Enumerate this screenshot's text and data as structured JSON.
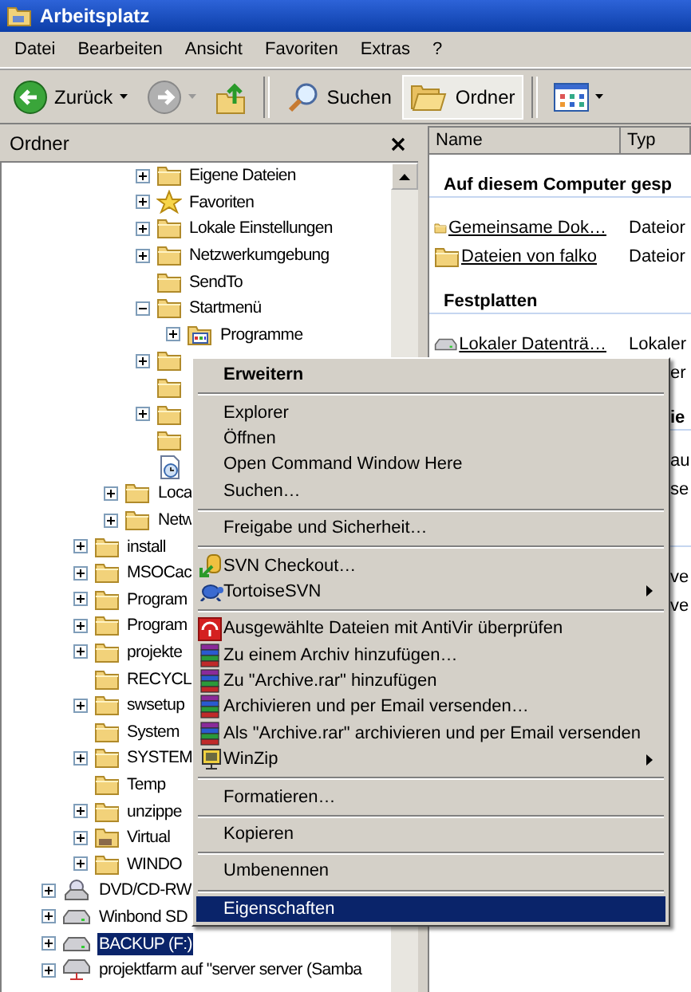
{
  "window": {
    "title": "Arbeitsplatz"
  },
  "menu_bar": [
    "Datei",
    "Bearbeiten",
    "Ansicht",
    "Favoriten",
    "Extras",
    "?"
  ],
  "toolbar": [
    {
      "kind": "back",
      "label": "Zurück",
      "dropdown": true,
      "disabled": false,
      "selected": false
    },
    {
      "kind": "forward",
      "dropdown": true,
      "disabled": true,
      "selected": false
    },
    {
      "kind": "up",
      "selected": false
    },
    {
      "kind": "separator"
    },
    {
      "kind": "search",
      "label": "Suchen",
      "disabled": false,
      "selected": false
    },
    {
      "kind": "folders",
      "label": "Ordner",
      "disabled": false,
      "selected": true
    },
    {
      "kind": "separator"
    },
    {
      "kind": "views",
      "dropdown": true,
      "disabled": false,
      "selected": false
    }
  ],
  "folder_pane": {
    "title": "Ordner",
    "tree": [
      {
        "children": [
          {
            "children": [
              {
                "children": [
                  {
                    "kind": "folder",
                    "label": "Eigene Dateien",
                    "expandable": true,
                    "expanded": false,
                    "selected": false
                  },
                  {
                    "kind": "favorites",
                    "label": "Favoriten",
                    "expandable": true,
                    "expanded": false,
                    "selected": false
                  },
                  {
                    "kind": "folder",
                    "label": "Lokale Einstellungen",
                    "expandable": true,
                    "expanded": false,
                    "selected": false
                  },
                  {
                    "kind": "folder",
                    "label": "Netzwerkumgebung",
                    "expandable": true,
                    "expanded": false,
                    "selected": false
                  },
                  {
                    "kind": "folder",
                    "label": "SendTo",
                    "expandable": false,
                    "selected": false
                  },
                  {
                    "kind": "folder",
                    "label": "Startmenü",
                    "expandable": true,
                    "expanded": true,
                    "selected": false,
                    "children": [
                      {
                        "kind": "programs",
                        "label": "Programme",
                        "expandable": true,
                        "expanded": false,
                        "selected": false
                      }
                    ]
                  },
                  {
                    "kind": "folder",
                    "expandable": true,
                    "expanded": false
                  },
                  {
                    "kind": "folder",
                    "expandable": false
                  },
                  {
                    "kind": "folder",
                    "expandable": true,
                    "expanded": false
                  },
                  {
                    "kind": "folder",
                    "expandable": false
                  },
                  {
                    "kind": "document",
                    "expandable": false
                  }
                ]
              },
              {
                "kind": "folder",
                "label": "Loca",
                "expandable": true,
                "expanded": false,
                "selected": false
              },
              {
                "kind": "folder",
                "label": "Netw",
                "expandable": true,
                "expanded": false,
                "selected": false
              }
            ]
          },
          {
            "kind": "folder",
            "label": "install",
            "expandable": true,
            "expanded": false,
            "selected": false
          },
          {
            "kind": "folder",
            "label": "MSOCac",
            "expandable": true,
            "expanded": false,
            "selected": false
          },
          {
            "kind": "folder",
            "label": "Program",
            "expandable": true,
            "expanded": false,
            "selected": false
          },
          {
            "kind": "folder",
            "label": "Program",
            "expandable": true,
            "expanded": false,
            "selected": false
          },
          {
            "kind": "folder",
            "label": "projekte",
            "expandable": true,
            "expanded": false,
            "selected": false
          },
          {
            "kind": "folder",
            "label": "RECYCL",
            "expandable": false,
            "selected": false
          },
          {
            "kind": "folder",
            "label": "swsetup",
            "expandable": true,
            "expanded": false,
            "selected": false
          },
          {
            "kind": "folder",
            "label": "System",
            "expandable": false,
            "selected": false
          },
          {
            "kind": "folder",
            "label": "SYSTEM",
            "expandable": true,
            "expanded": false,
            "selected": false
          },
          {
            "kind": "folder",
            "label": "Temp",
            "expandable": false,
            "selected": false
          },
          {
            "kind": "folder",
            "label": "unzippe",
            "expandable": true,
            "expanded": false,
            "selected": false
          },
          {
            "kind": "special-folder",
            "label": "Virtual",
            "expandable": true,
            "expanded": false,
            "selected": false
          },
          {
            "kind": "folder",
            "label": "WINDO",
            "expandable": true,
            "expanded": false,
            "selected": false
          }
        ]
      },
      {
        "kind": "cd-drive",
        "label": "DVD/CD-RW",
        "expandable": true,
        "expanded": false,
        "selected": false
      },
      {
        "kind": "drive",
        "label": "Winbond SD",
        "expandable": true,
        "expanded": false,
        "selected": false
      },
      {
        "kind": "drive",
        "label": "BACKUP (F:)",
        "expandable": true,
        "expanded": false,
        "selected": true
      },
      {
        "kind": "network-drive",
        "label": "projektfarm auf \"server server (Samba",
        "expandable": true,
        "expanded": false,
        "selected": false
      }
    ]
  },
  "content_pane": {
    "columns": [
      "Name",
      "Typ"
    ],
    "groups": [
      {
        "title": "Auf diesem Computer gesp",
        "covered": false,
        "items": [
          {
            "kind": "folder",
            "name": "Gemeinsame Dok…",
            "type": "Dateior",
            "covered": false
          },
          {
            "kind": "folder",
            "name": "Dateien von falko",
            "type": "Dateior",
            "covered": false
          }
        ]
      },
      {
        "title": "Festplatten",
        "covered": false,
        "items": [
          {
            "kind": "drive",
            "name": "Lokaler Datenträ…",
            "type": "Lokaler",
            "covered": false
          },
          {
            "text": "er",
            "covered": true
          }
        ]
      },
      {
        "title": "ie",
        "covered": true,
        "items": [
          {
            "text": "au",
            "covered": true
          },
          {
            "text": "se",
            "covered": true
          }
        ]
      },
      {
        "items": [
          {
            "text": "ve",
            "covered": true
          },
          {
            "text": "ve",
            "covered": true
          }
        ]
      }
    ]
  },
  "context_menu": [
    {
      "kind": "item",
      "label": "Erweitern",
      "bold": true,
      "submenu": false,
      "selected": false
    },
    {
      "kind": "separator"
    },
    {
      "kind": "item",
      "label": "Explorer",
      "bold": false,
      "submenu": false,
      "selected": false
    },
    {
      "kind": "item",
      "label": "Öffnen",
      "bold": false,
      "submenu": false,
      "selected": false
    },
    {
      "kind": "item",
      "label": "Open Command Window Here",
      "bold": false,
      "submenu": false,
      "selected": false
    },
    {
      "kind": "item",
      "label": "Suchen…",
      "bold": false,
      "submenu": false,
      "selected": false
    },
    {
      "kind": "separator"
    },
    {
      "kind": "item",
      "label": "Freigabe und Sicherheit…",
      "bold": false,
      "submenu": false,
      "selected": false
    },
    {
      "kind": "separator"
    },
    {
      "kind": "checkout",
      "label": "SVN Checkout…",
      "bold": false,
      "submenu": false,
      "selected": false
    },
    {
      "kind": "tortoise",
      "label": "TortoiseSVN",
      "bold": false,
      "submenu": true,
      "selected": false
    },
    {
      "kind": "separator"
    },
    {
      "kind": "antivir",
      "label": "Ausgewählte Dateien mit AntiVir überprüfen",
      "bold": false,
      "submenu": false,
      "selected": false
    },
    {
      "kind": "archive",
      "label": "Zu einem Archiv hinzufügen…",
      "bold": false,
      "submenu": false,
      "selected": false
    },
    {
      "kind": "archive",
      "label": "Zu \"Archive.rar\" hinzufügen",
      "bold": false,
      "submenu": false,
      "selected": false
    },
    {
      "kind": "archive",
      "label": "Archivieren und per Email versenden…",
      "bold": false,
      "submenu": false,
      "selected": false
    },
    {
      "kind": "archive",
      "label": "Als \"Archive.rar\" archivieren und per Email versenden",
      "bold": false,
      "submenu": false,
      "selected": false
    },
    {
      "kind": "winzip",
      "label": "WinZip",
      "bold": false,
      "submenu": true,
      "selected": false
    },
    {
      "kind": "separator"
    },
    {
      "kind": "item",
      "label": "Formatieren…",
      "bold": false,
      "submenu": false,
      "selected": false
    },
    {
      "kind": "separator"
    },
    {
      "kind": "item",
      "label": "Kopieren",
      "bold": false,
      "submenu": false,
      "selected": false
    },
    {
      "kind": "separator"
    },
    {
      "kind": "item",
      "label": "Umbenennen",
      "bold": false,
      "submenu": false,
      "selected": false
    },
    {
      "kind": "separator"
    },
    {
      "kind": "item",
      "label": "Eigenschaften",
      "bold": false,
      "submenu": false,
      "selected": true
    }
  ]
}
